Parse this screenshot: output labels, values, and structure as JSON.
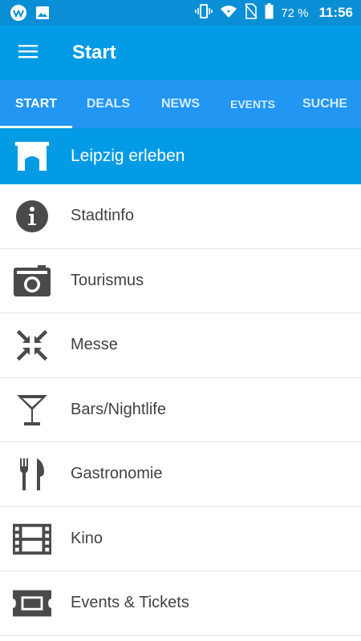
{
  "status_bar": {
    "battery": "72 %",
    "time": "11:56",
    "icons": [
      "app-notification-icon",
      "image-icon",
      "vibrate-icon",
      "wifi-icon",
      "no-sim-icon",
      "battery-icon"
    ]
  },
  "app_bar": {
    "title": "Start",
    "menu_icon": "hamburger-menu-icon"
  },
  "tabs": [
    {
      "label": "START",
      "active": true
    },
    {
      "label": "DEALS",
      "active": false
    },
    {
      "label": "NEWS",
      "active": false
    },
    {
      "label": "EVENTS",
      "active": false
    },
    {
      "label": "SUCHE",
      "active": false
    }
  ],
  "hero": {
    "label": "Leipzig erleben",
    "icon": "gate-icon"
  },
  "items": [
    {
      "label": "Stadtinfo",
      "icon": "info-icon"
    },
    {
      "label": "Tourismus",
      "icon": "camera-icon"
    },
    {
      "label": "Messe",
      "icon": "collapse-arrows-icon"
    },
    {
      "label": "Bars/Nightlife",
      "icon": "cocktail-icon"
    },
    {
      "label": "Gastronomie",
      "icon": "cutlery-icon"
    },
    {
      "label": "Kino",
      "icon": "film-icon"
    },
    {
      "label": "Events & Tickets",
      "icon": "ticket-icon"
    }
  ],
  "colors": {
    "status_bar": "#0a8fd6",
    "app_bar": "#039be5",
    "tab_bar": "#2196f3",
    "icon_gray": "#4a4a4a",
    "text": "#424242"
  }
}
